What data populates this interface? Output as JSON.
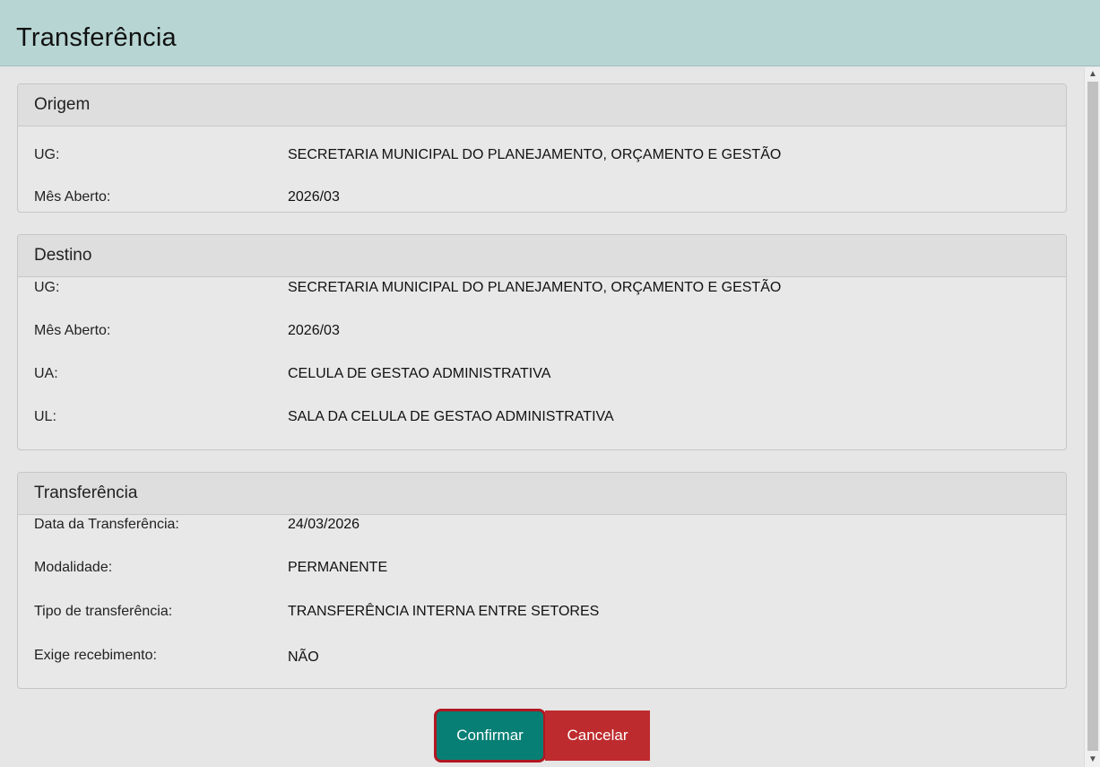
{
  "header": {
    "title": "Transferência"
  },
  "origem": {
    "title": "Origem",
    "rows": [
      {
        "label": "UG:",
        "value": "SECRETARIA MUNICIPAL DO PLANEJAMENTO, ORÇAMENTO E GESTÃO"
      },
      {
        "label": "Mês Aberto:",
        "value": "2026/03"
      }
    ]
  },
  "destino": {
    "title": "Destino",
    "rows": [
      {
        "label": "UG:",
        "value": "SECRETARIA MUNICIPAL DO PLANEJAMENTO, ORÇAMENTO E GESTÃO"
      },
      {
        "label": "Mês Aberto:",
        "value": "2026/03"
      },
      {
        "label": "UA:",
        "value": "CELULA DE GESTAO ADMINISTRATIVA"
      },
      {
        "label": "UL:",
        "value": "SALA DA CELULA DE GESTAO ADMINISTRATIVA"
      }
    ]
  },
  "transferencia": {
    "title": "Transferência",
    "rows": [
      {
        "label": "Data da Transferência:",
        "value": "24/03/2026"
      },
      {
        "label": "Modalidade:",
        "value": "PERMANENTE"
      },
      {
        "label": "Tipo de transferência:",
        "value": "TRANSFERÊNCIA INTERNA ENTRE SETORES"
      },
      {
        "label": "Exige recebimento:",
        "value": "NÃO"
      }
    ]
  },
  "buttons": {
    "confirm": "Confirmar",
    "cancel": "Cancelar"
  },
  "colors": {
    "header_bg": "#b7d6d3",
    "confirm_bg": "#087f75",
    "cancel_bg": "#be2b2e",
    "focus_outline": "#b01822"
  }
}
